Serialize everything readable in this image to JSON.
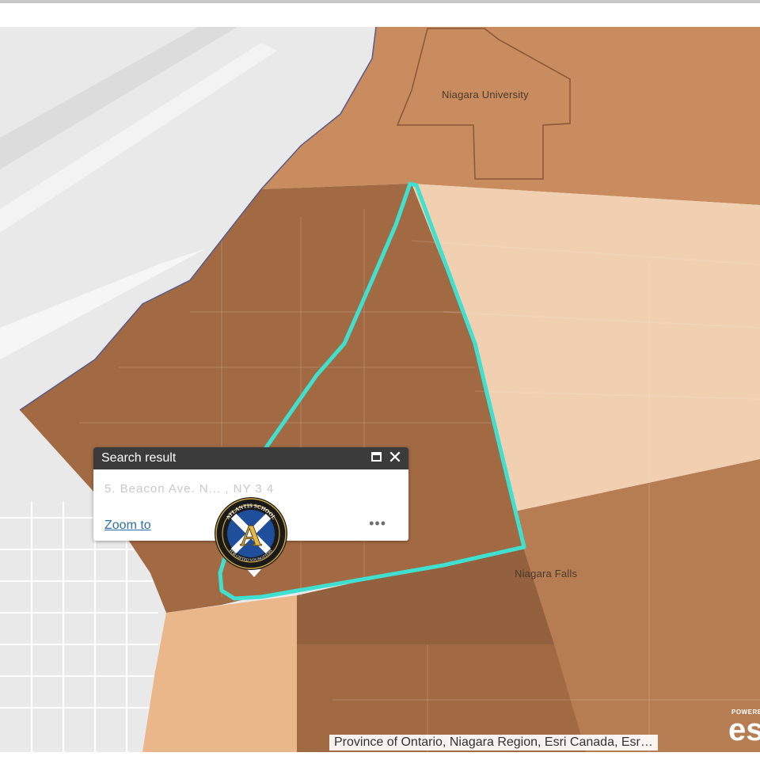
{
  "map": {
    "labels": {
      "niagara_university": "Niagara University",
      "niagara_falls": "Niagara Falls"
    },
    "colors": {
      "river_land": "#e9e9e9",
      "tract_dark": "#a26a43",
      "tract_mid": "#c88c5e",
      "tract_light": "#f0d0b0",
      "tract_lighter": "#e9b78a",
      "tract_darker": "#94613e",
      "highlight_outline": "#3fe0d0"
    },
    "attribution": "Province of Ontario, Niagara Region, Esri Canada, Esr…"
  },
  "popup": {
    "title": "Search result",
    "body_text": "5. Beacon Ave. N... , NY 3 4",
    "zoom_label": "Zoom to",
    "more_label": "•••"
  },
  "logo": {
    "text_top": "ATLANTIS SCHOOL",
    "text_bottom": "FOR GIFTED YOUNGSTERS",
    "letter": "A"
  },
  "esri": {
    "powered": "POWERED",
    "word": "esri"
  }
}
